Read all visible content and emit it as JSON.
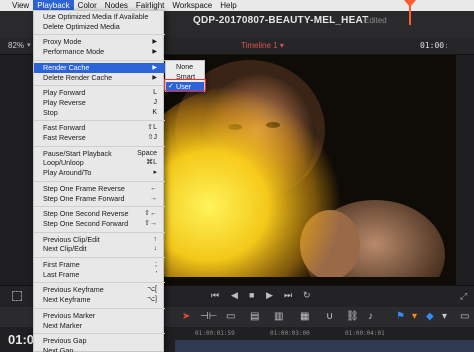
{
  "menubar": {
    "items": [
      {
        "label": "View",
        "active": false
      },
      {
        "label": "Playback",
        "active": true
      },
      {
        "label": "Color",
        "active": false
      },
      {
        "label": "Nodes",
        "active": false
      },
      {
        "label": "Fairlight",
        "active": false
      },
      {
        "label": "Workspace",
        "active": false
      },
      {
        "label": "Help",
        "active": false
      }
    ]
  },
  "titlebar": {
    "project_title": "QDP-20170807-BEAUTY-MEL_HEAT",
    "edited_label": "Edited"
  },
  "toolbar": {
    "zoom": "82%",
    "timeline_name": "Timeline 1",
    "timecode": "01:00"
  },
  "playback_menu": {
    "top_items": [
      {
        "label": "Use Optimized Media If Available"
      },
      {
        "label": "Delete Optimized Media"
      }
    ],
    "groups": [
      [
        {
          "label": "Proxy Mode",
          "submenu": true
        },
        {
          "label": "Performance Mode",
          "submenu": true
        }
      ],
      [
        {
          "label": "Render Cache",
          "submenu": true,
          "highlighted": true
        },
        {
          "label": "Delete Render Cache",
          "submenu": true
        }
      ],
      [
        {
          "label": "Play Forward",
          "shortcut": "L"
        },
        {
          "label": "Play Reverse",
          "shortcut": "J"
        },
        {
          "label": "Stop",
          "shortcut": "K"
        }
      ],
      [
        {
          "label": "Fast Forward",
          "shortcut": "⇧L"
        },
        {
          "label": "Fast Reverse",
          "shortcut": "⇧J"
        }
      ],
      [
        {
          "label": "Pause/Start Playback",
          "shortcut": "Space"
        },
        {
          "label": "Loop/Unloop",
          "shortcut": "⌘L"
        },
        {
          "label": "Play Around/To",
          "shortcut": "▸"
        }
      ],
      [
        {
          "label": "Step One Frame Reverse",
          "shortcut": "←"
        },
        {
          "label": "Step One Frame Forward",
          "shortcut": "→"
        }
      ],
      [
        {
          "label": "Step One Second Reverse",
          "shortcut": "⇧←"
        },
        {
          "label": "Step One Second Forward",
          "shortcut": "⇧→"
        }
      ],
      [
        {
          "label": "Previous Clip/Edit",
          "shortcut": "↑"
        },
        {
          "label": "Next Clip/Edit",
          "shortcut": "↓"
        }
      ],
      [
        {
          "label": "First Frame",
          "shortcut": ";"
        },
        {
          "label": "Last Frame",
          "shortcut": "'"
        }
      ],
      [
        {
          "label": "Previous Keyframe",
          "shortcut": "⌥["
        },
        {
          "label": "Next Keyframe",
          "shortcut": "⌥]"
        }
      ],
      [
        {
          "label": "Previous Marker",
          "shortcut": ""
        },
        {
          "label": "Next Marker",
          "shortcut": ""
        }
      ],
      [
        {
          "label": "Previous Gap",
          "shortcut": ""
        },
        {
          "label": "Next Gap",
          "shortcut": ""
        }
      ]
    ]
  },
  "render_cache_submenu": {
    "options": [
      {
        "label": "None",
        "checked": false
      },
      {
        "label": "Smart",
        "checked": false
      },
      {
        "label": "User",
        "checked": true
      }
    ]
  },
  "ruler": {
    "current_timecode": "01:0",
    "marks": [
      "01:00:01:59",
      "01:00:03:00",
      "01:00:04:01"
    ]
  },
  "colors": {
    "accent": "#2c63d6",
    "playhead": "#ff5a2a",
    "timeline_name": "#d9544f",
    "highlight_frame": "#ff2a2a"
  },
  "icons": {
    "transport": [
      "first-frame-icon",
      "reverse-icon",
      "stop-icon",
      "play-icon",
      "next-frame-icon",
      "loop-icon"
    ],
    "edit_tools": [
      "selection-icon",
      "trim-icon",
      "blade-icon",
      "link-icon",
      "snap-icon",
      "flag-icon",
      "marker-icon"
    ]
  }
}
